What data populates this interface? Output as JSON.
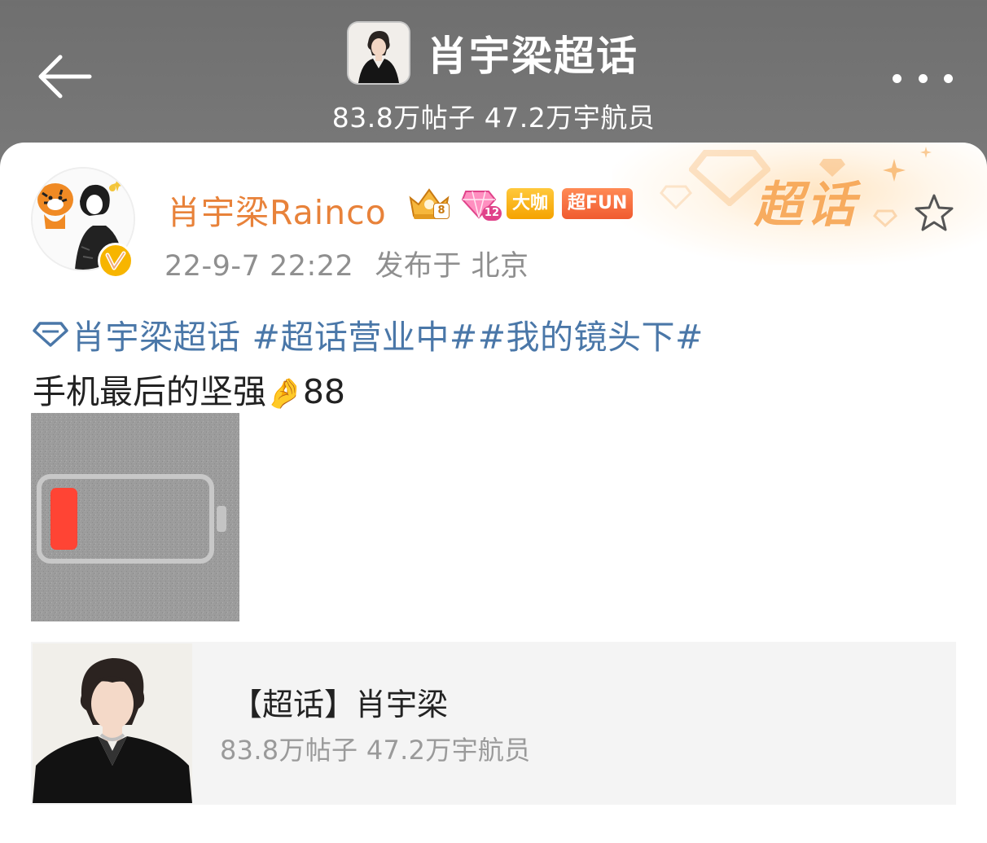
{
  "header": {
    "title": "肖宇梁超话",
    "stats": "83.8万帖子 47.2万宇航员",
    "back_icon": "arrow-left-icon",
    "more_icon": "more-horizontal-icon"
  },
  "post": {
    "author": {
      "name": "肖宇梁Rainco",
      "badges": {
        "level": "8",
        "gem_level": "12",
        "daka": "大咖",
        "fun": "超FUN"
      }
    },
    "time": "22-9-7 22:22",
    "location": "发布于 北京",
    "topic_label": "超话",
    "super_topic": "肖宇梁超话",
    "hashtags": "#超话营业中##我的镜头下#",
    "body_text": "手机最后的坚强",
    "body_emoji": "🤌",
    "body_suffix": "88",
    "image": {
      "description_icon": "low-battery-icon",
      "battery_level": 0.1
    }
  },
  "topic_card": {
    "title": "【超话】肖宇梁",
    "stats": "83.8万帖子 47.2万宇航员"
  },
  "colors": {
    "author_name": "#e8823a",
    "link_blue": "#4a77a8",
    "battery_red": "#ff4434",
    "chaohua_orange": "#f6a04a"
  }
}
